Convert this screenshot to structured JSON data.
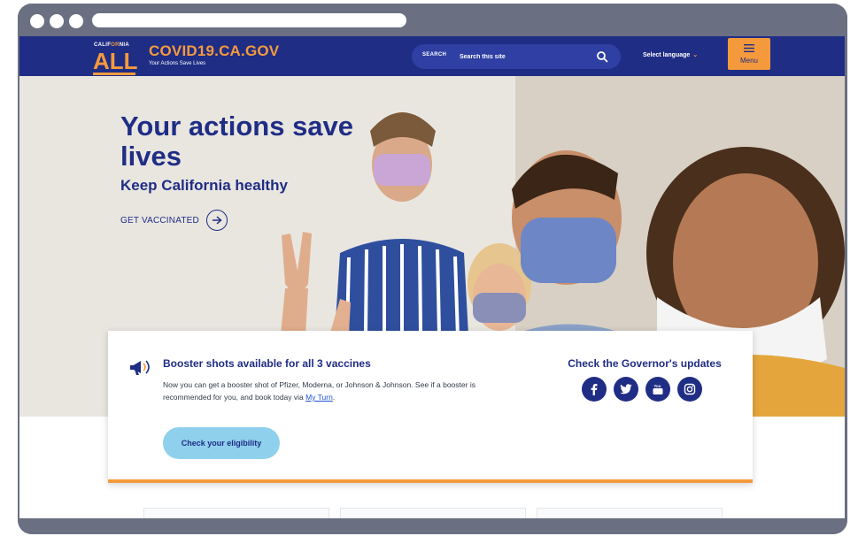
{
  "header": {
    "logo_top_1": "CALIF",
    "logo_top_2": "OR",
    "logo_top_3": "NIA",
    "logo_main": "ALL",
    "site_name": "COVID19.CA.GOV",
    "tagline": "Your Actions Save Lives",
    "search_label": "SEARCH",
    "search_placeholder": "Search this site",
    "language_label": "Select language",
    "menu_label": "Menu"
  },
  "hero": {
    "title": "Your actions save lives",
    "subtitle": "Keep California healthy",
    "cta_label": "GET VACCINATED"
  },
  "card": {
    "title": "Booster shots available for all 3 vaccines",
    "body_text": "Now you can get a booster shot of Pfizer, Moderna, or Johnson & Johnson. See if a booster is recommended for you, and book today via ",
    "body_link": "My Turn",
    "body_end": ".",
    "button_label": "Check your eligibility",
    "governor_title": "Check the Governor's updates",
    "socials": [
      "facebook-icon",
      "twitter-icon",
      "youtube-icon",
      "instagram-icon"
    ]
  },
  "colors": {
    "brand_blue": "#1f2d85",
    "brand_orange": "#f59a3c",
    "button_light_blue": "#8fd0ec"
  }
}
